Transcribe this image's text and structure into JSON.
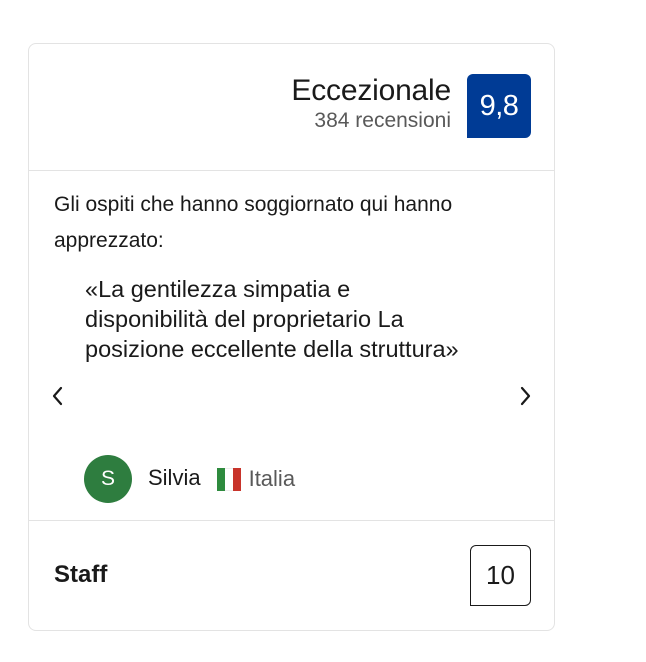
{
  "header": {
    "rating_word": "Eccezionale",
    "review_count": "384 recensioni",
    "score": "9,8"
  },
  "liked": {
    "heading": "Gli ospiti che hanno soggiornato qui hanno apprezzato:",
    "quote": "«La gentilezza simpatia e disponibilità del proprietario La posizione eccellente della struttura»"
  },
  "reviewer": {
    "initial": "S",
    "name": "Silvia",
    "country": "Italia",
    "flag_colors": [
      "#2e8b3e",
      "#ffffff",
      "#c8342b"
    ]
  },
  "navigation": {
    "prev_icon": "chevron-left-icon",
    "next_icon": "chevron-right-icon"
  },
  "category": {
    "label": "Staff",
    "score": "10"
  },
  "colors": {
    "badge_bg": "#003b95",
    "avatar_bg": "#2e7d3f"
  }
}
